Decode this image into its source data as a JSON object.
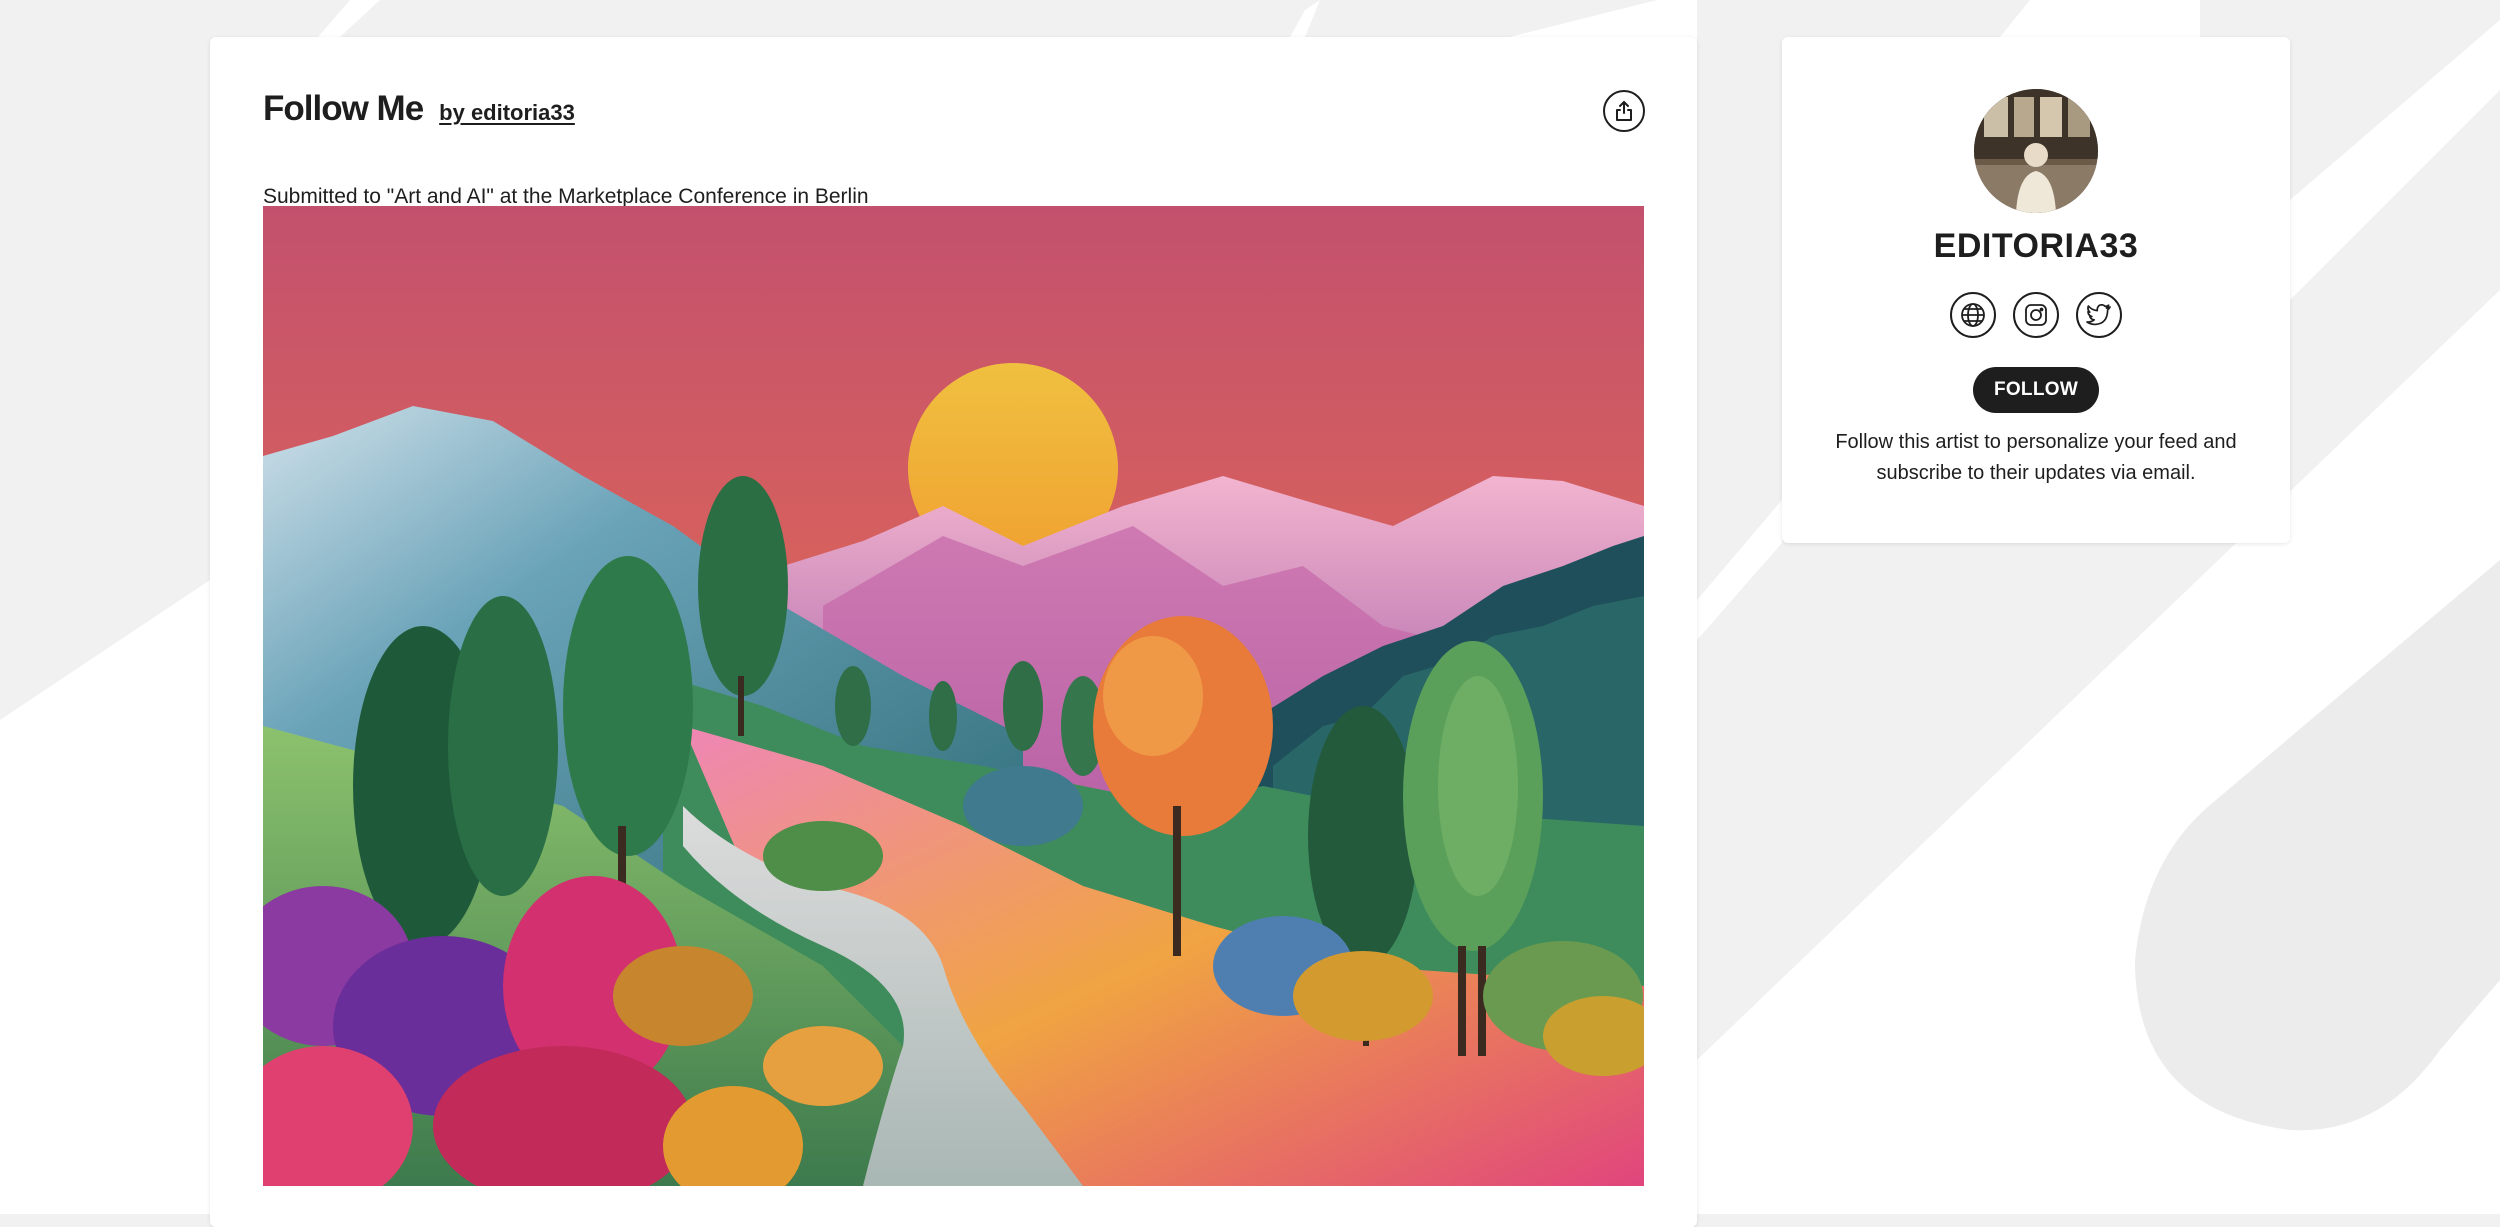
{
  "artwork": {
    "title": "Follow Me",
    "by_label": "by editoria33",
    "submitted_prefix": "Submitted to ",
    "contest_link": "\"Art and AI\" at the Marketplace Conference in Berlin",
    "image_alt": "Colorful landscape painting with sunset, mountains, trees and winding path"
  },
  "header": {
    "share_icon": "share-icon"
  },
  "profile": {
    "name": "EDITORIA33",
    "follow_label": "FOLLOW",
    "follow_note": "Follow this artist to personalize your feed and subscribe to their updates via email.",
    "social": [
      {
        "icon": "globe-icon"
      },
      {
        "icon": "instagram-icon"
      },
      {
        "icon": "twitter-icon"
      }
    ]
  },
  "colors": {
    "page_background": "#f1f1f1",
    "card_background": "#ffffff",
    "text": "#1e1e1e",
    "button": "#1e1e1e"
  }
}
